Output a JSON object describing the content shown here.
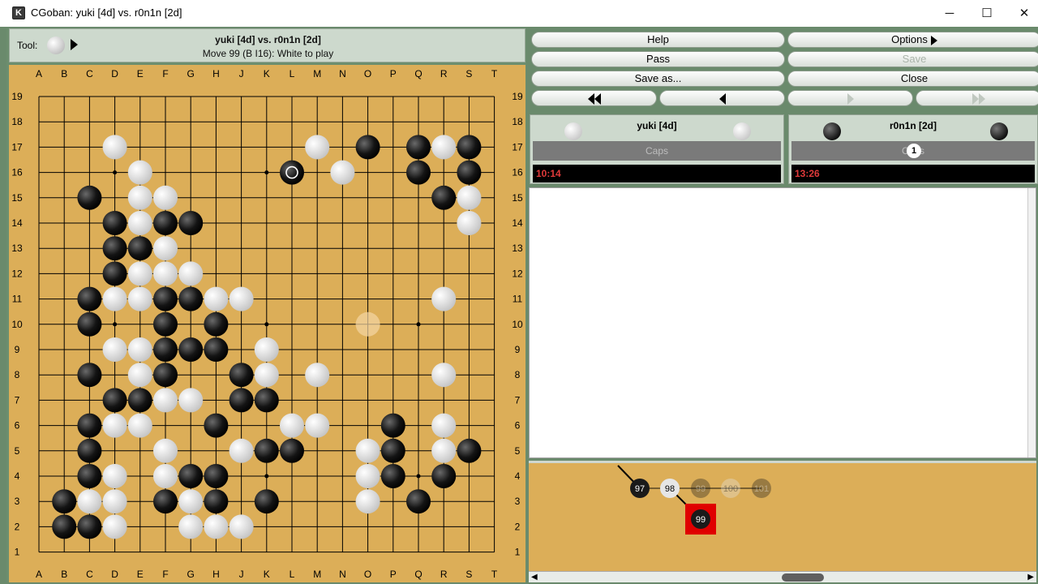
{
  "window": {
    "title": "CGoban: yuki [4d] vs. r0n1n [2d]",
    "icon": "K",
    "minimize": "─",
    "maximize": "☐",
    "close": "✕"
  },
  "toolbar": {
    "tool_label": "Tool:",
    "game_title": "yuki [4d] vs. r0n1n [2d]",
    "move_info": "Move 99 (B I16): White to play"
  },
  "board": {
    "columns": [
      "A",
      "B",
      "C",
      "D",
      "E",
      "F",
      "G",
      "H",
      "J",
      "K",
      "L",
      "M",
      "N",
      "O",
      "P",
      "Q",
      "R",
      "S",
      "T"
    ],
    "rows": [
      "19",
      "18",
      "17",
      "16",
      "15",
      "14",
      "13",
      "12",
      "11",
      "10",
      "9",
      "8",
      "7",
      "6",
      "5",
      "4",
      "3",
      "2",
      "1"
    ],
    "black_stones": [
      "O17",
      "Q17",
      "S17",
      "L16",
      "Q16",
      "S16",
      "C15",
      "R15",
      "D14",
      "F14",
      "G14",
      "D13",
      "E13",
      "D12",
      "C11",
      "F11",
      "G11",
      "C10",
      "F10",
      "H10",
      "F9",
      "G9",
      "H9",
      "C8",
      "F8",
      "J8",
      "D7",
      "E7",
      "J7",
      "K7",
      "C6",
      "H6",
      "P6",
      "C5",
      "K5",
      "L5",
      "P5",
      "S5",
      "C4",
      "G4",
      "H4",
      "P4",
      "R4",
      "B3",
      "F3",
      "H3",
      "K3",
      "Q3",
      "B2",
      "C2"
    ],
    "white_stones": [
      "D17",
      "M17",
      "R17",
      "E16",
      "N16",
      "E15",
      "F15",
      "S15",
      "E14",
      "S14",
      "F13",
      "E12",
      "F12",
      "G12",
      "D11",
      "E11",
      "H11",
      "J11",
      "R11",
      "D9",
      "E9",
      "K9",
      "E8",
      "K8",
      "M8",
      "R8",
      "F7",
      "G7",
      "D6",
      "E6",
      "L6",
      "M6",
      "R6",
      "F5",
      "J5",
      "O5",
      "R5",
      "D4",
      "F4",
      "O4",
      "C3",
      "D3",
      "G3",
      "O3",
      "D2",
      "G2",
      "H2",
      "J2"
    ],
    "last_move": "L16",
    "ghost_stone": "O10"
  },
  "buttons": {
    "help": "Help",
    "options": "Options",
    "pass": "Pass",
    "save": "Save",
    "save_as": "Save as...",
    "close": "Close"
  },
  "players": {
    "white": {
      "name": "yuki [4d]",
      "caps": "Caps",
      "clock": "10:14"
    },
    "black": {
      "name": "r0n1n [2d]",
      "caps": "Caps",
      "caps_count": "1",
      "clock": "13:26"
    }
  },
  "tree": {
    "nodes": [
      "97",
      "98",
      "99",
      "100",
      "101"
    ],
    "current": "99"
  },
  "colors": {
    "board": "#dcae58",
    "panel": "#6a8a6c",
    "clock_text": "#e03a3a",
    "current_node": "#e00000"
  }
}
